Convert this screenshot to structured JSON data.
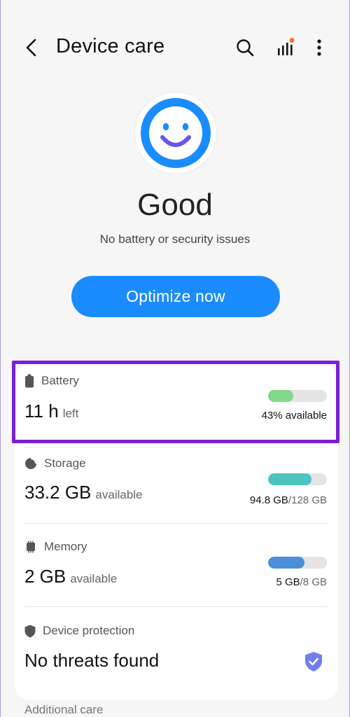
{
  "header": {
    "title": "Device care",
    "icons": [
      "back-arrow-icon",
      "search-icon",
      "stats-icon",
      "more-vert-icon"
    ],
    "badge_color": "#ff6a2a"
  },
  "status": {
    "face_icon": "smiley-face-icon",
    "title": "Good",
    "subtitle": "No battery or security issues",
    "accent": "#1a8cff"
  },
  "actions": {
    "optimize_label": "Optimize now"
  },
  "items": {
    "battery": {
      "label": "Battery",
      "value": "11 h",
      "unit": "left",
      "meta": "43% available",
      "fill_percent": 43,
      "color": "#7fd888"
    },
    "storage": {
      "label": "Storage",
      "value": "33.2 GB",
      "unit": "available",
      "meta_used": "94.8 GB",
      "meta_total": "/128 GB",
      "fill_percent": 74,
      "color": "#4cc5c0"
    },
    "memory": {
      "label": "Memory",
      "value": "2 GB",
      "unit": "available",
      "meta_used": "5 GB",
      "meta_total": "/8 GB",
      "fill_percent": 62,
      "color": "#4a90d9"
    },
    "protection": {
      "label": "Device protection",
      "value": "No threats found",
      "shield_color": "#6f7ff0"
    }
  },
  "footer": {
    "section_label": "Additional care"
  }
}
